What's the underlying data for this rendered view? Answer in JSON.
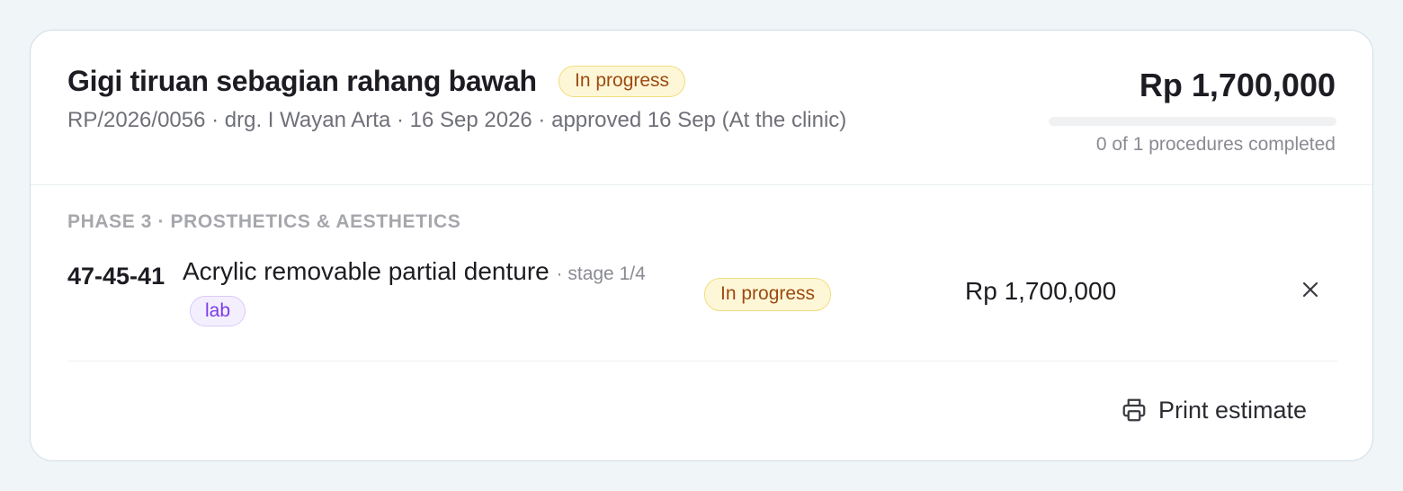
{
  "plan": {
    "title": "Gigi tiruan sebagian rahang bawah",
    "status": "In progress",
    "subline": "RP/2026/0056 · drg. I Wayan Arta · 16 Sep 2026 · approved 16 Sep (At the clinic)",
    "total": "Rp 1,700,000",
    "progress_fraction": 0,
    "progress_text": "0 of 1 procedures completed"
  },
  "phase": {
    "label": "PHASE 3 · PROSTHETICS & AESTHETICS",
    "procedures": [
      {
        "teeth": "47-45-41",
        "name": "Acrylic removable partial denture",
        "stage": "· stage 1/4",
        "tag": "lab",
        "status": "In progress",
        "price": "Rp 1,700,000"
      }
    ]
  },
  "actions": {
    "print_label": "Print estimate"
  },
  "colors": {
    "status_badge_bg": "#fdf7d8",
    "status_badge_text": "#9c4a10",
    "lab_tag_text": "#7a3be6"
  },
  "icons": {
    "remove": "close-icon",
    "print": "printer-icon"
  }
}
